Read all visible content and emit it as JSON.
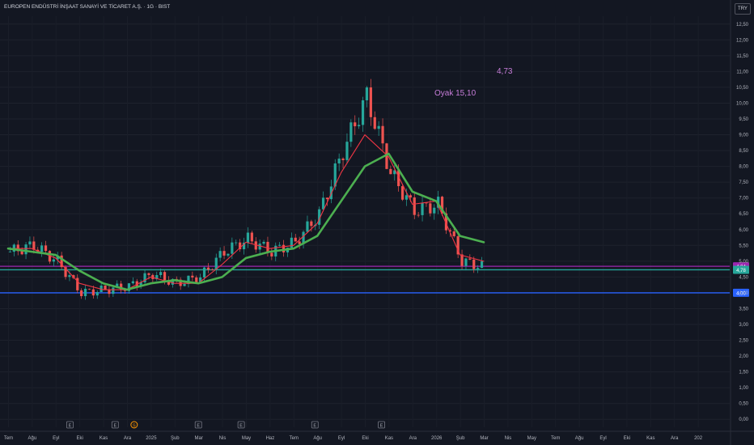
{
  "header": {
    "title": "EUROPEN ENDÜSTRİ İNŞAAT SANAYİ VE TİCARET A.Ş. · 1G · BIST",
    "currency": "TRY"
  },
  "annotations": [
    {
      "text": "4,73"
    },
    {
      "text": "Oyak 15,10"
    }
  ],
  "chart_data": {
    "type": "line",
    "title": "",
    "xlabel": "",
    "ylabel": "",
    "ylim": [
      -0.25,
      12.75
    ],
    "y_ticks": [
      "0,00",
      "0,50",
      "1,00",
      "1,50",
      "2,00",
      "2,50",
      "3,00",
      "3,50",
      "4,00",
      "4,50",
      "5,00",
      "5,50",
      "6,00",
      "6,50",
      "7,00",
      "7,50",
      "8,00",
      "8,50",
      "9,00",
      "9,50",
      "10,00",
      "10,50",
      "11,00",
      "11,50",
      "12,00",
      "12,50"
    ],
    "x_ticks": [
      "Tem",
      "Ağu",
      "Eyl",
      "Eki",
      "Kas",
      "Ara",
      "2025",
      "Şub",
      "Mar",
      "Nis",
      "May",
      "Haz",
      "Tem",
      "Ağu",
      "Eyl",
      "Eki",
      "Kas",
      "Ara",
      "2026",
      "Şub",
      "Mar",
      "Nis",
      "May",
      "Tem",
      "Ağu",
      "Eyl",
      "Eki",
      "Kas",
      "Ara",
      "202"
    ],
    "x": [
      "2024-07",
      "2024-08",
      "2024-09",
      "2024-10",
      "2024-11",
      "2024-12",
      "2025-01",
      "2025-02",
      "2025-03",
      "2025-04",
      "2025-05",
      "2025-06",
      "2025-07",
      "2025-08",
      "2025-09",
      "2025-10",
      "2025-11",
      "2025-12",
      "2026-01",
      "2026-02",
      "2026-03"
    ],
    "series": [
      {
        "values": [
          5.3,
          5.5,
          5.0,
          4.0,
          4.1,
          4.2,
          4.6,
          4.3,
          4.5,
          5.3,
          5.7,
          5.3,
          5.6,
          6.5,
          8.5,
          10.2,
          7.8,
          6.6,
          6.8,
          5.0,
          4.8
        ],
        "color": "#26a69a"
      },
      {
        "values": [
          5.4,
          5.4,
          5.1,
          4.3,
          4.1,
          4.1,
          4.5,
          4.3,
          4.3,
          4.9,
          5.6,
          5.4,
          5.5,
          6.2,
          7.8,
          9.0,
          8.3,
          6.8,
          6.9,
          5.2,
          5.0
        ],
        "color": "#f23645"
      },
      {
        "values": [
          5.4,
          5.3,
          5.2,
          4.7,
          4.3,
          4.1,
          4.3,
          4.4,
          4.3,
          4.5,
          5.1,
          5.3,
          5.4,
          5.8,
          6.9,
          8.0,
          8.4,
          7.2,
          6.9,
          5.8,
          5.6
        ],
        "color": "#4caf50"
      }
    ],
    "hlines": [
      {
        "value": 4.84,
        "label": "4,84",
        "color": "#9c27b0"
      },
      {
        "value": 4.78,
        "label": "4,78",
        "color": "#26a69a"
      },
      {
        "value": 4.0,
        "label": "4,00",
        "color": "#2962ff"
      }
    ],
    "events": [
      {
        "label": "E",
        "at": 2.6
      },
      {
        "label": "E",
        "at": 4.5
      },
      {
        "label": "S",
        "at": 5.3
      },
      {
        "label": "E",
        "at": 8.0
      },
      {
        "label": "E",
        "at": 9.8
      },
      {
        "label": "E",
        "at": 12.9
      },
      {
        "label": "E",
        "at": 15.7
      }
    ]
  }
}
